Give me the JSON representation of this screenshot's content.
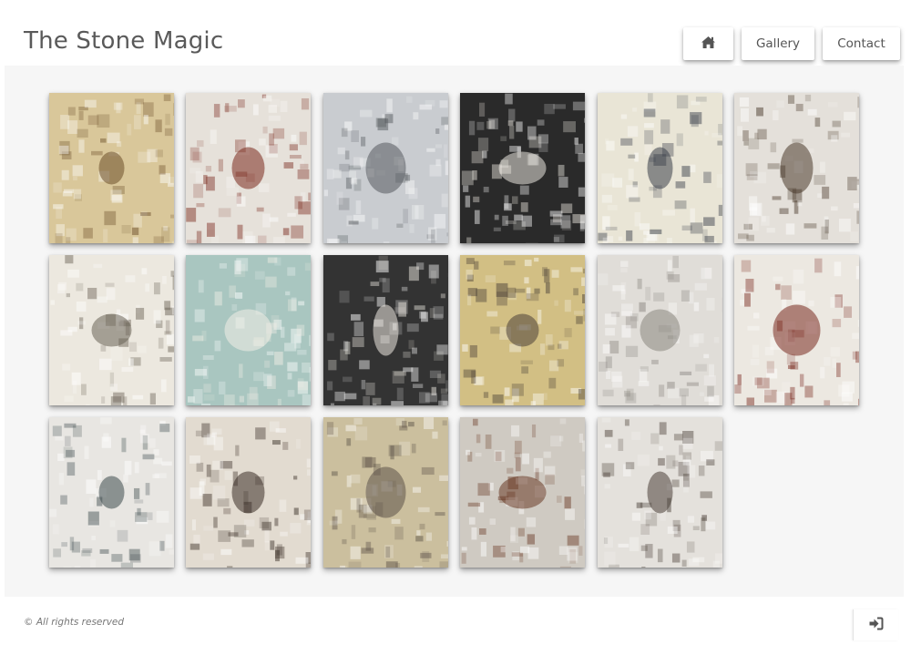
{
  "header": {
    "title": "The Stone Magic",
    "nav": [
      {
        "id": "home",
        "label": "",
        "icon": "home-icon"
      },
      {
        "id": "gallery",
        "label": "Gallery"
      },
      {
        "id": "contact",
        "label": "Contact"
      }
    ]
  },
  "gallery": {
    "tiles": [
      {
        "icon": "mosaic-image",
        "bg": "#d9c79a",
        "accent": "#6b4e2a"
      },
      {
        "icon": "mosaic-image",
        "bg": "#e6e1da",
        "accent": "#7a2a1e"
      },
      {
        "icon": "mosaic-image",
        "bg": "#c9ccd0",
        "accent": "#555a5e"
      },
      {
        "icon": "mosaic-image",
        "bg": "#2a2a2a",
        "accent": "#e8e4dc"
      },
      {
        "icon": "mosaic-image",
        "bg": "#e9e5d6",
        "accent": "#3a3f4a"
      },
      {
        "icon": "mosaic-image",
        "bg": "#e4e0da",
        "accent": "#4a3a2c"
      },
      {
        "icon": "mosaic-image",
        "bg": "#ece8df",
        "accent": "#6a6256"
      },
      {
        "icon": "mosaic-image",
        "bg": "#a9c6c0",
        "accent": "#f2efe6"
      },
      {
        "icon": "mosaic-image",
        "bg": "#333333",
        "accent": "#ece8e0"
      },
      {
        "icon": "mosaic-image",
        "bg": "#d2bf84",
        "accent": "#4a4038"
      },
      {
        "icon": "mosaic-image",
        "bg": "#e0ddd8",
        "accent": "#8a8680"
      },
      {
        "icon": "mosaic-image",
        "bg": "#ece8e1",
        "accent": "#7a2a20"
      },
      {
        "icon": "mosaic-image",
        "bg": "#e8e6e2",
        "accent": "#3c4a4c"
      },
      {
        "icon": "mosaic-image",
        "bg": "#e2dbd0",
        "accent": "#3a2e26"
      },
      {
        "icon": "mosaic-image",
        "bg": "#cbbf9e",
        "accent": "#5c5248"
      },
      {
        "icon": "mosaic-image",
        "bg": "#cfcac2",
        "accent": "#6a3a26"
      },
      {
        "icon": "mosaic-image",
        "bg": "#e4e1dc",
        "accent": "#4a4038"
      }
    ]
  },
  "footer": {
    "copyright": "© All rights reserved",
    "login_icon": "sign-in-icon"
  },
  "colors": {
    "page_bg": "#ffffff",
    "content_bg": "#f6f6f6",
    "text": "#5a5a5a"
  }
}
